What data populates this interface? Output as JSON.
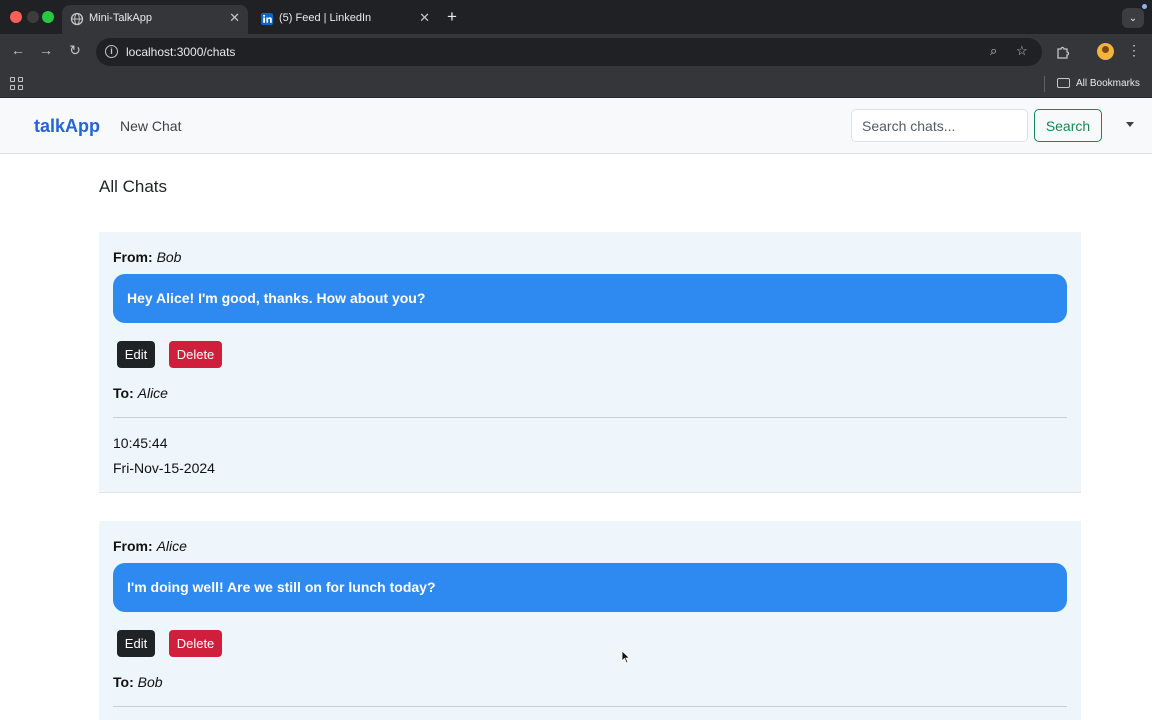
{
  "browser": {
    "tabs": [
      {
        "title": "Mini-TalkApp",
        "active": true,
        "icon": "globe-icon"
      },
      {
        "title": "(5) Feed | LinkedIn",
        "active": false,
        "icon": "linkedin-icon"
      }
    ],
    "url": "localhost:3000/chats",
    "bookmarks_label": "All Bookmarks"
  },
  "navbar": {
    "brand": "talkApp",
    "new_chat_label": "New Chat",
    "search_placeholder": "Search chats...",
    "search_button": "Search"
  },
  "page": {
    "title": "All Chats"
  },
  "chats": [
    {
      "from_label": "From:",
      "from": "Bob",
      "message": "Hey Alice! I'm good, thanks. How about you?",
      "edit_label": "Edit",
      "delete_label": "Delete",
      "to_label": "To:",
      "to": "Alice",
      "time": "10:45:44",
      "date": "Fri-Nov-15-2024"
    },
    {
      "from_label": "From:",
      "from": "Alice",
      "message": "I'm doing well! Are we still on for lunch today?",
      "edit_label": "Edit",
      "delete_label": "Delete",
      "to_label": "To:",
      "to": "Bob"
    }
  ],
  "colors": {
    "brand": "#2563d6",
    "bubble": "#2e89f1",
    "card_bg": "#eef6fb",
    "edit_btn": "#1f2326",
    "delete_btn": "#d01f3c",
    "search_btn": "#198754"
  }
}
